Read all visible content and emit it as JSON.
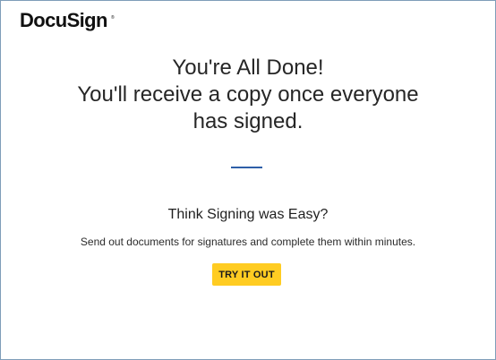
{
  "brand": {
    "logo_text": "DocuSign",
    "trademark": "®"
  },
  "confirmation": {
    "line1": "You're All Done!",
    "line2": "You'll receive a copy once everyone",
    "line3": "has signed."
  },
  "promo": {
    "heading": "Think Signing was Easy?",
    "description": "Send out documents for signatures and complete them within minutes.",
    "button_label": "TRY IT OUT"
  },
  "colors": {
    "accent_button": "#ffcc22",
    "divider": "#2e5fa8",
    "frame_border": "#7f9db9"
  }
}
